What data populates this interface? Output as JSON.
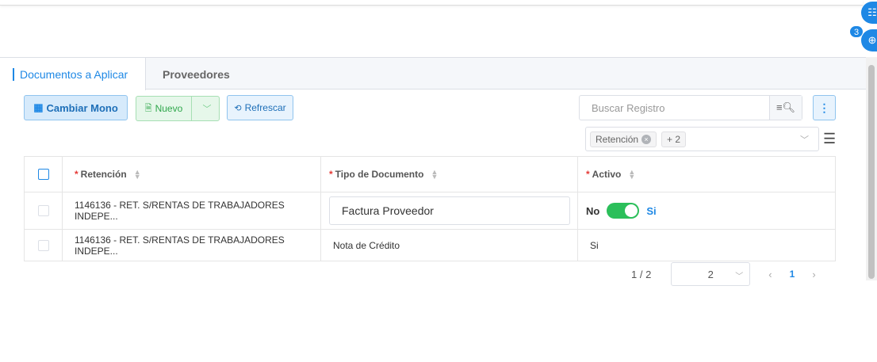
{
  "fabs": {
    "badge_count": "3"
  },
  "tabs": [
    {
      "label": "Documentos a Aplicar",
      "active": true
    },
    {
      "label": "Proveedores",
      "active": false
    }
  ],
  "toolbar": {
    "cambiar_mono_label": "Cambiar Mono",
    "nuevo_label": "Nuevo",
    "refrescar_label": "Refrescar"
  },
  "search": {
    "placeholder": "Buscar Registro",
    "value": ""
  },
  "filter": {
    "chips": [
      "Retención",
      "+ 2"
    ]
  },
  "table": {
    "columns": [
      "Retención",
      "Tipo de Documento",
      "Activo"
    ],
    "rows": [
      {
        "retencion": "1146136 - RET. S/RENTAS DE TRABAJADORES INDEPE...",
        "tipo": "Factura Proveedor",
        "activo_no": "No",
        "activo_si": "Si",
        "editing": true
      },
      {
        "retencion": "1146136 - RET. S/RENTAS DE TRABAJADORES INDEPE...",
        "tipo": "Nota de Crédito",
        "activo": "Si",
        "editing": false
      }
    ]
  },
  "pager": {
    "count": "1 / 2",
    "page_size": "2",
    "current_page": "1"
  },
  "colors": {
    "accent": "#1e88e5",
    "success": "#2bbf5a",
    "danger": "#e53935"
  }
}
